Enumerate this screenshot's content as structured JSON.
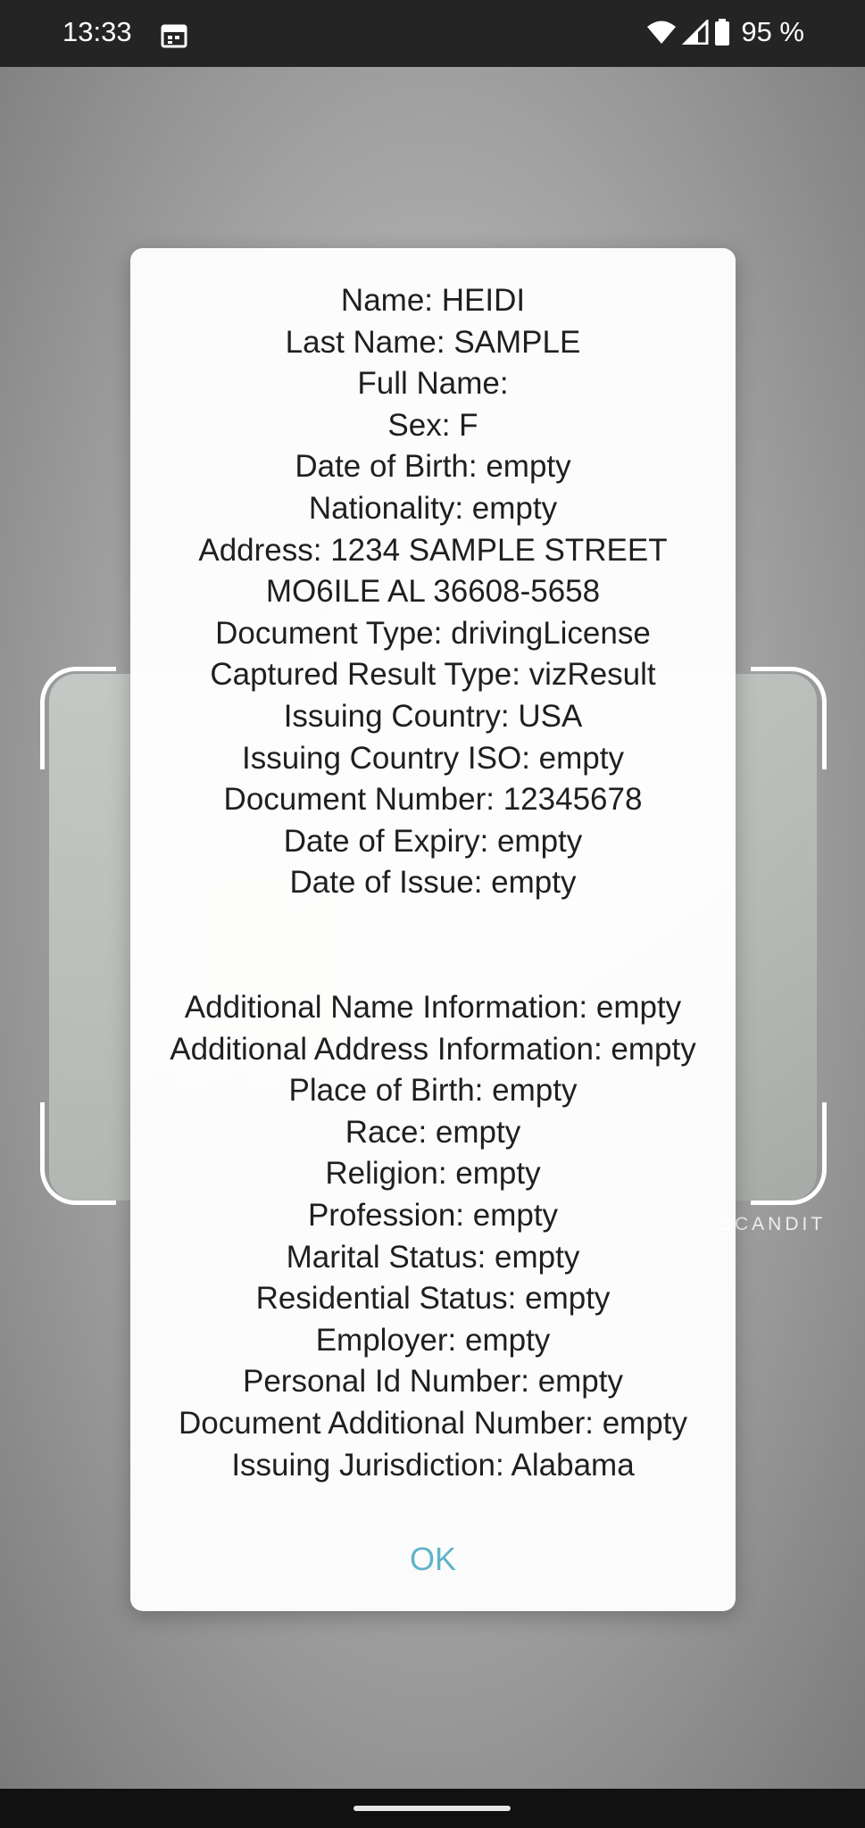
{
  "status_bar": {
    "time": "13:33",
    "battery_percent": "95 %",
    "icons": [
      "calendar-icon",
      "wifi-icon",
      "cellular-signal-icon",
      "battery-icon"
    ]
  },
  "camera_overlay": {
    "watermark": "SCANDIT"
  },
  "dialog": {
    "lines": [
      "Name: HEIDI",
      "Last Name: SAMPLE",
      "Full Name:",
      "Sex: F",
      "Date of Birth: empty",
      "Nationality: empty",
      "Address: 1234 SAMPLE STREET",
      "MO6ILE AL 36608-5658",
      "Document Type: drivingLicense",
      "Captured Result Type: vizResult",
      "Issuing Country: USA",
      "Issuing Country ISO: empty",
      "Document Number: 12345678",
      "Date of Expiry: empty",
      "Date of Issue: empty",
      "",
      "",
      "Additional Name Information: empty",
      "Additional Address Information: empty",
      "Place of Birth: empty",
      "Race: empty",
      "Religion: empty",
      "Profession: empty",
      "Marital Status: empty",
      "Residential Status: empty",
      "Employer: empty",
      "Personal Id Number: empty",
      "Document Additional Number: empty",
      "Issuing Jurisdiction: Alabama"
    ],
    "ok_label": "OK"
  },
  "colors": {
    "accent": "#5fb4c8",
    "status_bar": "#242424",
    "dialog_text": "#1f1f1f"
  }
}
